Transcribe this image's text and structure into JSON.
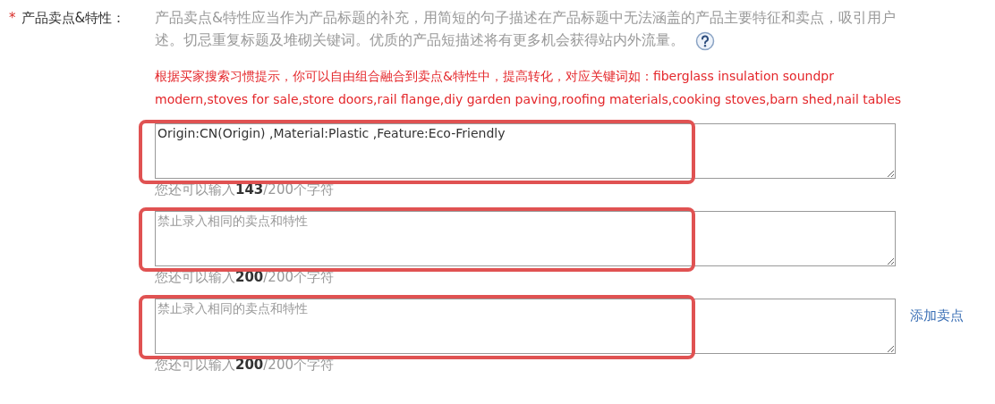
{
  "field": {
    "required_mark": "*",
    "label": "产品卖点&特性：",
    "help_lines": [
      "产品卖点&特性应当作为产品标题的补充，用简短的句子描述在产品标题中无法涵盖的产品主要特征和卖点，吸引用户",
      "述。切忌重复标题及堆砌关键词。优质的产品短描述将有更多机会获得站内外流量。"
    ],
    "hint_lines": [
      "根据买家搜索习惯提示，你可以自由组合融合到卖点&特性中，提高转化，对应关键词如：fiberglass insulation soundpr",
      "modern,stoves for sale,store doors,rail flange,diy garden paving,roofing materials,cooking stoves,barn shed,nail tables"
    ],
    "inputs": [
      {
        "value": "Origin:CN(Origin) ,Material:Plastic ,Feature:Eco-Friendly",
        "counter": "您还可以输入**143**/200个字符",
        "highlighted": true
      },
      {
        "placeholder": "禁止录入相同的卖点和特性",
        "counter": "您还可以输入**200**/200个字符",
        "highlighted": true
      },
      {
        "placeholder": "禁止录入相同的卖点和特性",
        "counter": "您还可以输入**200**/200个字符",
        "highlighted": true,
        "add_link": "添加卖点"
      }
    ]
  }
}
